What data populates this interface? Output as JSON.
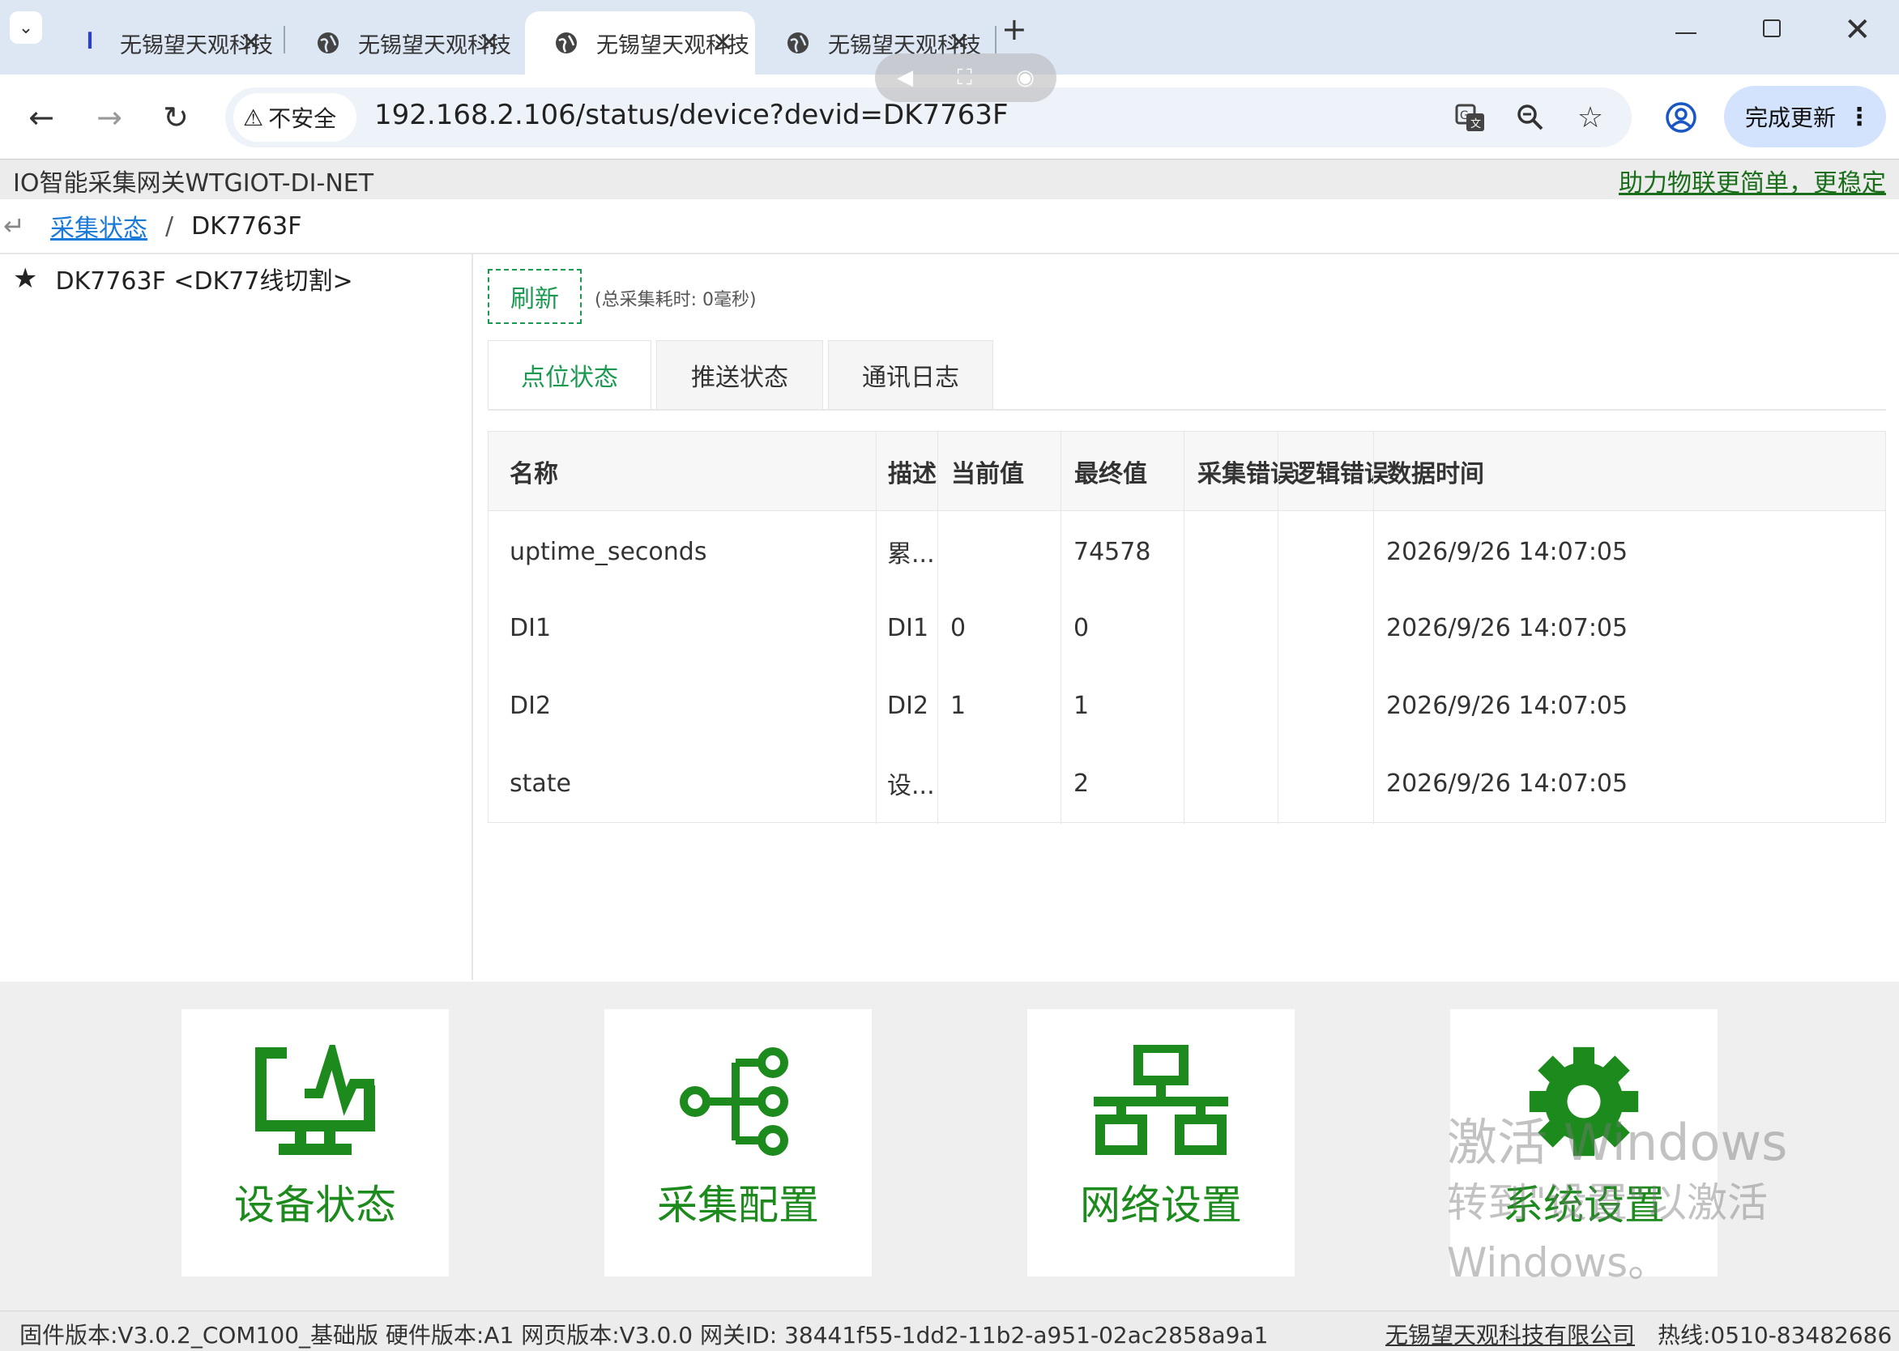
{
  "browser": {
    "tabs": [
      {
        "title": "无锡望天观科技有限公",
        "active": false
      },
      {
        "title": "无锡望天观科技有限公",
        "active": false
      },
      {
        "title": "无锡望天观科技有限公",
        "active": true
      },
      {
        "title": "无锡望天观科技有限公",
        "active": false
      }
    ],
    "tab_close": "×",
    "new_tab": "+",
    "security_label": "不安全",
    "url": "192.168.2.106/status/device?devid=DK7763F",
    "update_label": "完成更新"
  },
  "app": {
    "title": "IO智能采集网关WTGIOT-DI-NET",
    "slogan": "助力物联更简单，更稳定"
  },
  "breadcrumb": {
    "back": "↵",
    "link": "采集状态",
    "separator": "/",
    "current": "DK7763F"
  },
  "sidebar": {
    "device": "DK7763F <DK77线切割>"
  },
  "toolbar": {
    "refresh_label": "刷新",
    "cost_note": "(总采集耗时: 0毫秒)"
  },
  "panel_tabs": [
    "点位状态",
    "推送状态",
    "通讯日志"
  ],
  "table": {
    "columns": [
      "名称",
      "描述",
      "当前值",
      "最终值",
      "采集错误",
      "逻辑错误",
      "数据时间"
    ],
    "rows": [
      {
        "name": "uptime_seconds",
        "desc": "累...",
        "current": "",
        "final": "74578",
        "collect_err": "",
        "logic_err": "",
        "time": "2026/9/26 14:07:05"
      },
      {
        "name": "DI1",
        "desc": "DI1",
        "current": "0",
        "final": "0",
        "collect_err": "",
        "logic_err": "",
        "time": "2026/9/26 14:07:05"
      },
      {
        "name": "DI2",
        "desc": "DI2",
        "current": "1",
        "final": "1",
        "collect_err": "",
        "logic_err": "",
        "time": "2026/9/26 14:07:05"
      },
      {
        "name": "state",
        "desc": "设...",
        "current": "",
        "final": "2",
        "collect_err": "",
        "logic_err": "",
        "time": "2026/9/26 14:07:05"
      }
    ]
  },
  "tiles": [
    {
      "label": "设备状态",
      "icon": "monitor-pulse-icon"
    },
    {
      "label": "采集配置",
      "icon": "hierarchy-icon"
    },
    {
      "label": "网络设置",
      "icon": "network-icon"
    },
    {
      "label": "系统设置",
      "icon": "gear-icon"
    }
  ],
  "watermark": {
    "line1": "激活 Windows",
    "line2": "转到\"设置\"以激活",
    "line3": "Windows。"
  },
  "footer": {
    "firmware": "固件版本:V3.0.2_COM100_基础版  硬件版本:A1  网页版本:V3.0.0  网关ID: 38441f55-1dd2-11b2-a951-02ac2858a9a1",
    "company": "无锡望天观科技有限公司",
    "hotline": "热线:0510-83482686"
  },
  "colors": {
    "accent_green": "#1a9a50",
    "tile_green": "#1c8a1c",
    "link_blue": "#1a7ad9",
    "tabbar_bg": "#dde6f3"
  }
}
